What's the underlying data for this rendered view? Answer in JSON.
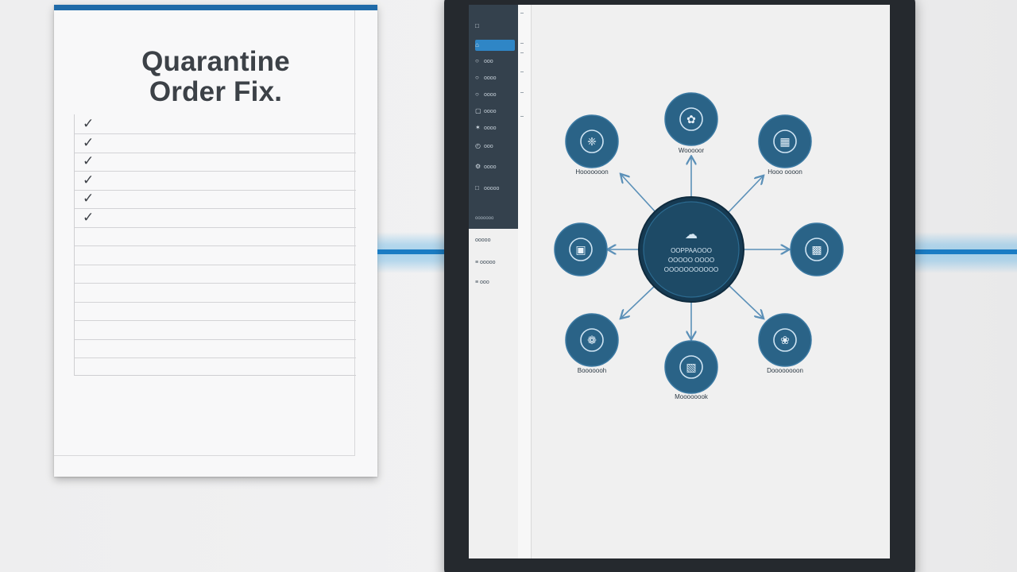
{
  "document": {
    "title_line1": "Quarantine",
    "title_line2": "Order Fix.",
    "checked_rows": 6,
    "total_rows": 13
  },
  "app": {
    "sidebar": {
      "items": [
        {
          "label": "",
          "icon": "window-icon"
        },
        {
          "label": "",
          "icon": "home-icon",
          "active": true
        },
        {
          "label": "ooo",
          "icon": "globe-icon"
        },
        {
          "label": "oooo",
          "icon": "circle-icon"
        },
        {
          "label": "oooo",
          "icon": "circle-icon"
        },
        {
          "label": "oooo",
          "icon": "document-icon"
        },
        {
          "label": "oooo",
          "icon": "star-icon"
        },
        {
          "label": "ooo",
          "icon": "clock-icon"
        },
        {
          "label": "oooo",
          "icon": "settings-icon"
        },
        {
          "label": "ooooo",
          "icon": "window-icon"
        }
      ],
      "footer": "ooooooo",
      "lower_items": [
        {
          "label": "ooooo",
          "icon": ""
        },
        {
          "label": "ooooo",
          "icon": "list-icon"
        },
        {
          "label": "ooo",
          "icon": "list-icon"
        }
      ]
    },
    "diagram": {
      "hub": {
        "line1": "OOPPAAOOO",
        "line2": "OOOOO OOOO",
        "line3": "OOOOOOOOOOO"
      },
      "nodes": [
        {
          "id": "top",
          "label": "Wooooor"
        },
        {
          "id": "top-left",
          "label": "Hooooooon"
        },
        {
          "id": "top-right",
          "label": "Hooo oooon"
        },
        {
          "id": "left",
          "label": ""
        },
        {
          "id": "right",
          "label": ""
        },
        {
          "id": "bottom-left",
          "label": "Booooooh"
        },
        {
          "id": "bottom",
          "label": "Moooooook"
        },
        {
          "id": "bottom-right",
          "label": "Doooooooon"
        }
      ]
    }
  },
  "colors": {
    "accent": "#1f6aa8",
    "node_fill": "#2a6387",
    "hub_fill": "#1d4a66",
    "sidebar_bg": "#34414d",
    "beam": "#1a7cc4"
  }
}
